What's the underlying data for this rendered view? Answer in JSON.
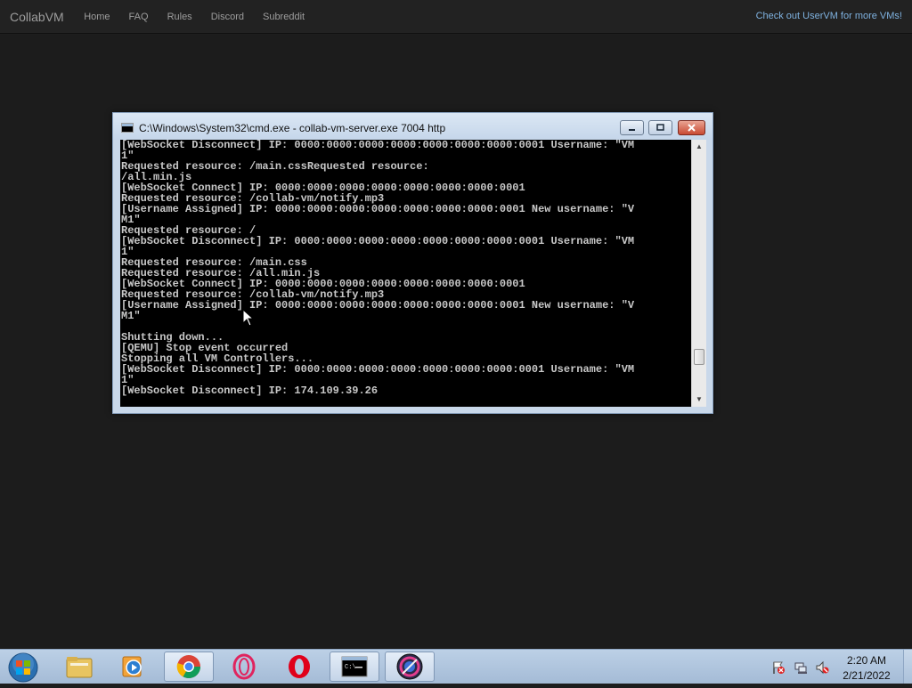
{
  "navbar": {
    "brand": "CollabVM",
    "links": [
      "Home",
      "FAQ",
      "Rules",
      "Discord",
      "Subreddit"
    ],
    "right_link": "Check out UserVM for more VMs!"
  },
  "window": {
    "title": "C:\\Windows\\System32\\cmd.exe - collab-vm-server.exe 7004 http",
    "console_text": "[WebSocket Disconnect] IP: 0000:0000:0000:0000:0000:0000:0000:0001 Username: \"VM\n1\"\nRequested resource: /main.cssRequested resource:\n/all.min.js\n[WebSocket Connect] IP: 0000:0000:0000:0000:0000:0000:0000:0001\nRequested resource: /collab-vm/notify.mp3\n[Username Assigned] IP: 0000:0000:0000:0000:0000:0000:0000:0001 New username: \"V\nM1\"\nRequested resource: /\n[WebSocket Disconnect] IP: 0000:0000:0000:0000:0000:0000:0000:0001 Username: \"VM\n1\"\nRequested resource: /main.css\nRequested resource: /all.min.js\n[WebSocket Connect] IP: 0000:0000:0000:0000:0000:0000:0000:0001\nRequested resource: /collab-vm/notify.mp3\n[Username Assigned] IP: 0000:0000:0000:0000:0000:0000:0000:0001 New username: \"V\nM1\"\n\nShutting down...\n[QEMU] Stop event occurred\nStopping all VM Controllers...\n[WebSocket Disconnect] IP: 0000:0000:0000:0000:0000:0000:0000:0001 Username: \"VM\n1\"\n[WebSocket Disconnect] IP: 174.109.39.26"
  },
  "taskbar": {
    "items": [
      "windows-explorer",
      "windows-media-player",
      "google-chrome",
      "opera-gx",
      "opera",
      "command-prompt",
      "unknown-app"
    ],
    "active": [
      "google-chrome",
      "command-prompt",
      "unknown-app"
    ],
    "clock_time": "2:20 AM",
    "clock_date": "2/21/2022"
  },
  "colors": {
    "navbar_bg": "#222222",
    "desktop_bg": "#1c1c1c",
    "taskbar_bg": "#b3c8e0",
    "console_bg": "#000000",
    "console_fg": "#c8c8c8"
  }
}
